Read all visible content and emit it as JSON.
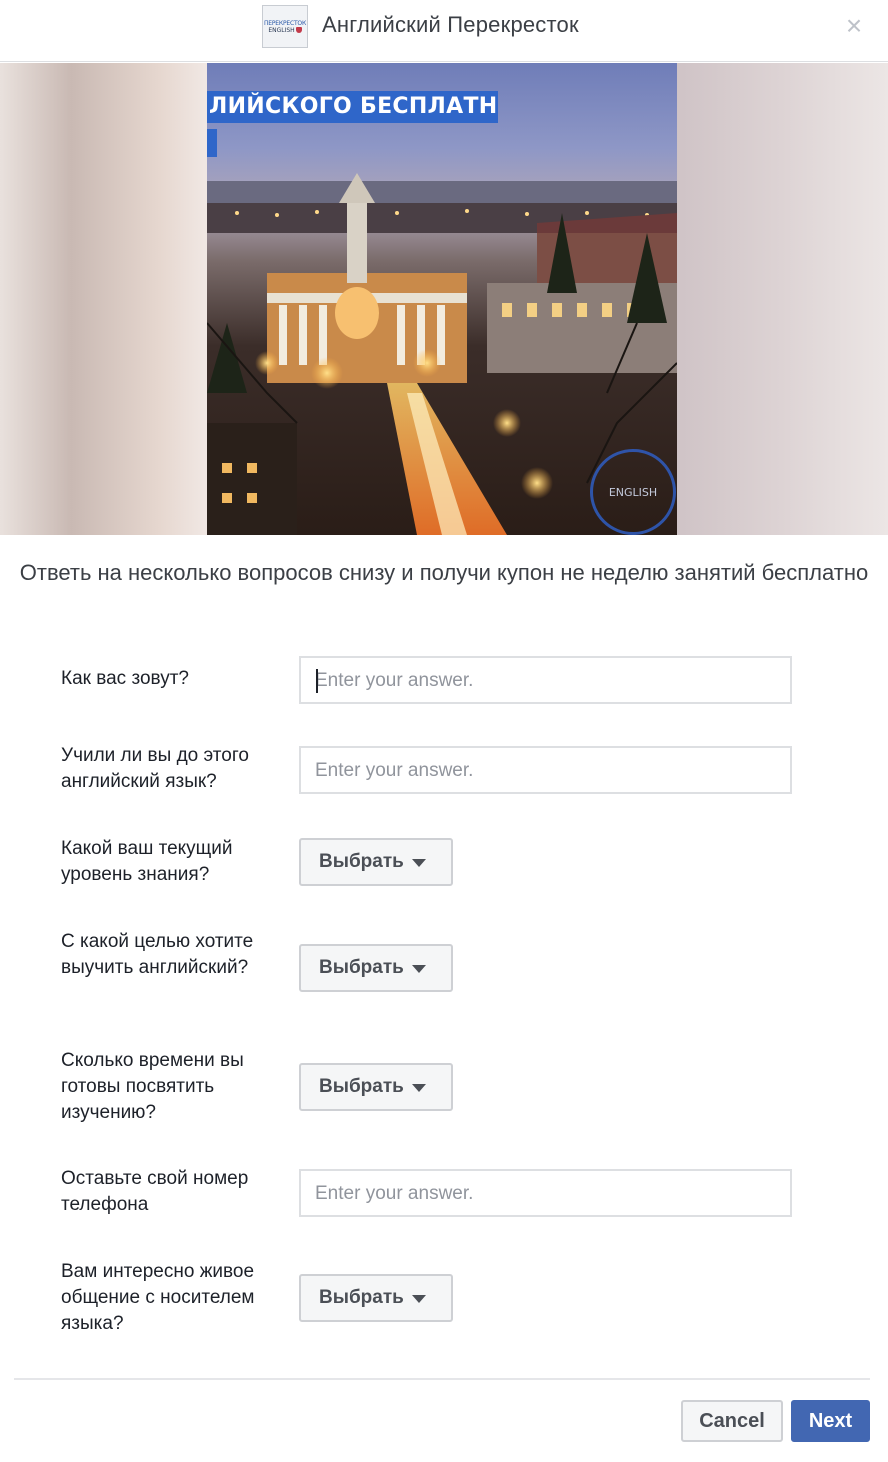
{
  "header": {
    "title": "Английский Перекресток",
    "logo_line1": "ПЕРЕКРЕСТОК",
    "logo_line2": "ENGLISH",
    "close_glyph": "×"
  },
  "media": {
    "banner_text": "ЛИЙСКОГО БЕСПЛАТНО",
    "watermark_text": "ENGLISH"
  },
  "intro": {
    "text": "Ответь на несколько вопросов снизу и получи купон не неделю занятий бесплатно"
  },
  "form": {
    "questions": [
      {
        "label": "Как вас зовут?",
        "type": "text",
        "placeholder": "Enter your answer."
      },
      {
        "label": "Учили ли вы до этого английский язык?",
        "type": "text",
        "placeholder": "Enter your answer."
      },
      {
        "label": "Какой ваш текущий уровень знания?",
        "type": "select",
        "button_label": "Выбрать"
      },
      {
        "label": "С какой целью хотите выучить английский?",
        "type": "select",
        "button_label": "Выбрать"
      },
      {
        "label": "Сколько времени вы готовы посвятить изучению?",
        "type": "select",
        "button_label": "Выбрать"
      },
      {
        "label": "Оставьте свой номер телефона",
        "type": "text",
        "placeholder": "Enter your answer."
      },
      {
        "label": "Вам интересно живое общение с носителем языка?",
        "type": "select",
        "button_label": "Выбрать"
      }
    ]
  },
  "footer": {
    "cancel_label": "Cancel",
    "next_label": "Next"
  },
  "colors": {
    "primary": "#4267b2",
    "banner": "#2f66c9",
    "text": "#1d2129",
    "placeholder": "#90949c",
    "border": "#dddfe2"
  }
}
